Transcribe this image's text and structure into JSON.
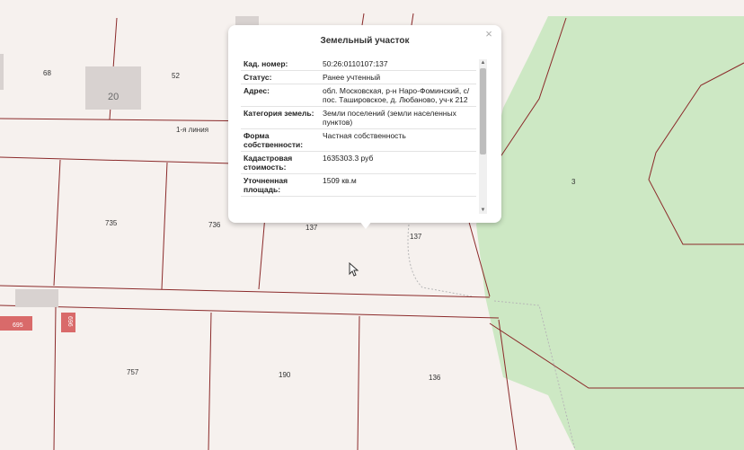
{
  "map": {
    "plot_numbers": [
      "68",
      "52",
      "735",
      "736",
      "137",
      "137",
      "3",
      "757",
      "190",
      "136"
    ],
    "building_number": "20",
    "street_label": "1-я линия",
    "red_plots": [
      "695",
      "696"
    ],
    "colors": {
      "background": "#f6f1ee",
      "boundary": "#8b2a2a",
      "forest": "#cde8c4",
      "building": "#d8d2d0",
      "red_plot": "#d96a6a"
    }
  },
  "popup": {
    "title": "Земельный участок",
    "close_icon": "close-icon",
    "rows": [
      {
        "key": "Кад. номер:",
        "value": "50:26:0110107:137"
      },
      {
        "key": "Статус:",
        "value": "Ранее учтенный"
      },
      {
        "key": "Адрес:",
        "value": "обл. Московская, р-н Наро-Фоминский, с/пос. Ташировское, д. Любаново, уч-к 212"
      },
      {
        "key": "Категория земель:",
        "value": "Земли поселений (земли населенных пунктов)"
      },
      {
        "key": "Форма собственности:",
        "value": "Частная собственность"
      },
      {
        "key": "Кадастровая стоимость:",
        "value": "1635303.3 руб"
      },
      {
        "key": "Уточненная площадь:",
        "value": "1509 кв.м"
      }
    ]
  }
}
